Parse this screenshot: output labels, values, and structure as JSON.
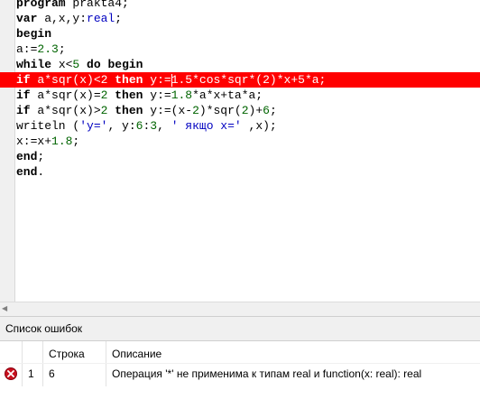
{
  "code": {
    "lines": [
      [
        {
          "t": "program",
          "c": "kw"
        },
        {
          "t": " prakta4;"
        }
      ],
      [
        {
          "t": "var",
          "c": "kw"
        },
        {
          "t": " a,x,y:"
        },
        {
          "t": "real",
          "c": "ty"
        },
        {
          "t": ";"
        }
      ],
      [
        {
          "t": "begin",
          "c": "kw"
        }
      ],
      [
        {
          "t": "a:="
        },
        {
          "t": "2.3",
          "c": "num"
        },
        {
          "t": ";"
        }
      ],
      [
        {
          "t": "while",
          "c": "kw"
        },
        {
          "t": " x<"
        },
        {
          "t": "5",
          "c": "num"
        },
        {
          "t": " "
        },
        {
          "t": "do",
          "c": "kw"
        },
        {
          "t": " "
        },
        {
          "t": "begin",
          "c": "kw"
        }
      ],
      [
        {
          "t": "if",
          "c": "kw"
        },
        {
          "t": " a*sqr(x)<"
        },
        {
          "t": "2",
          "c": "num"
        },
        {
          "t": " "
        },
        {
          "t": "then",
          "c": "kw"
        },
        {
          "t": " y:="
        },
        {
          "t": "",
          "c": "caret"
        },
        {
          "t": "1.5",
          "c": "num"
        },
        {
          "t": "*cos*sqr*("
        },
        {
          "t": "2",
          "c": "num"
        },
        {
          "t": ")*x+"
        },
        {
          "t": "5",
          "c": "num"
        },
        {
          "t": "*a;"
        }
      ],
      [
        {
          "t": "if",
          "c": "kw"
        },
        {
          "t": " a*sqr(x)="
        },
        {
          "t": "2",
          "c": "num"
        },
        {
          "t": " "
        },
        {
          "t": "then",
          "c": "kw"
        },
        {
          "t": " y:="
        },
        {
          "t": "1.8",
          "c": "num"
        },
        {
          "t": "*a*x+ta*a;"
        }
      ],
      [
        {
          "t": "if",
          "c": "kw"
        },
        {
          "t": " a*sqr(x)>"
        },
        {
          "t": "2",
          "c": "num"
        },
        {
          "t": " "
        },
        {
          "t": "then",
          "c": "kw"
        },
        {
          "t": " y:=(x-"
        },
        {
          "t": "2",
          "c": "num"
        },
        {
          "t": ")*sqr("
        },
        {
          "t": "2",
          "c": "num"
        },
        {
          "t": ")+"
        },
        {
          "t": "6",
          "c": "num"
        },
        {
          "t": ";"
        }
      ],
      [
        {
          "t": "writeln ("
        },
        {
          "t": "'y='",
          "c": "str"
        },
        {
          "t": ", y:"
        },
        {
          "t": "6",
          "c": "num"
        },
        {
          "t": ":"
        },
        {
          "t": "3",
          "c": "num"
        },
        {
          "t": ", "
        },
        {
          "t": "' якщо x='",
          "c": "str"
        },
        {
          "t": " ,x);"
        }
      ],
      [
        {
          "t": "x:=x+"
        },
        {
          "t": "1.8",
          "c": "num"
        },
        {
          "t": ";"
        }
      ],
      [
        {
          "t": "end",
          "c": "kw"
        },
        {
          "t": ";"
        }
      ],
      [
        {
          "t": "end",
          "c": "kw"
        },
        {
          "t": "."
        }
      ]
    ],
    "error_line_index": 5
  },
  "error_panel": {
    "title": "Список ошибок",
    "columns": {
      "line": "Строка",
      "description": "Описание"
    },
    "rows": [
      {
        "icon": "error-icon",
        "number": "1",
        "line": "6",
        "description": "Операция '*' не применима к типам real и function(x: real): real"
      }
    ]
  },
  "colors": {
    "error_highlight": "#ff0000",
    "keyword_type": "#0000c0",
    "number": "#006400"
  }
}
